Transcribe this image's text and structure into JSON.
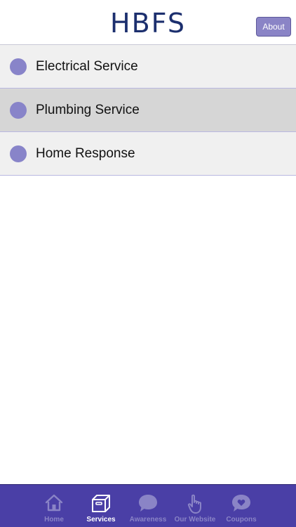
{
  "header": {
    "logo": "HBFS",
    "about_label": "About"
  },
  "services": {
    "items": [
      {
        "label": "Electrical Service"
      },
      {
        "label": "Plumbing Service"
      },
      {
        "label": "Home Response"
      }
    ],
    "selected_index": 1
  },
  "tabbar": {
    "tabs": [
      {
        "label": "Home",
        "icon": "house-icon"
      },
      {
        "label": "Services",
        "icon": "box-icon"
      },
      {
        "label": "Awareness",
        "icon": "speech-bubble-icon"
      },
      {
        "label": "Our Website",
        "icon": "pointing-hand-icon"
      },
      {
        "label": "Coupons",
        "icon": "heart-bubble-icon"
      }
    ],
    "active_index": 1
  },
  "colors": {
    "accent": "#8884c9",
    "tabbar_bg": "#4a3fa6",
    "logo": "#1c2f6e"
  }
}
